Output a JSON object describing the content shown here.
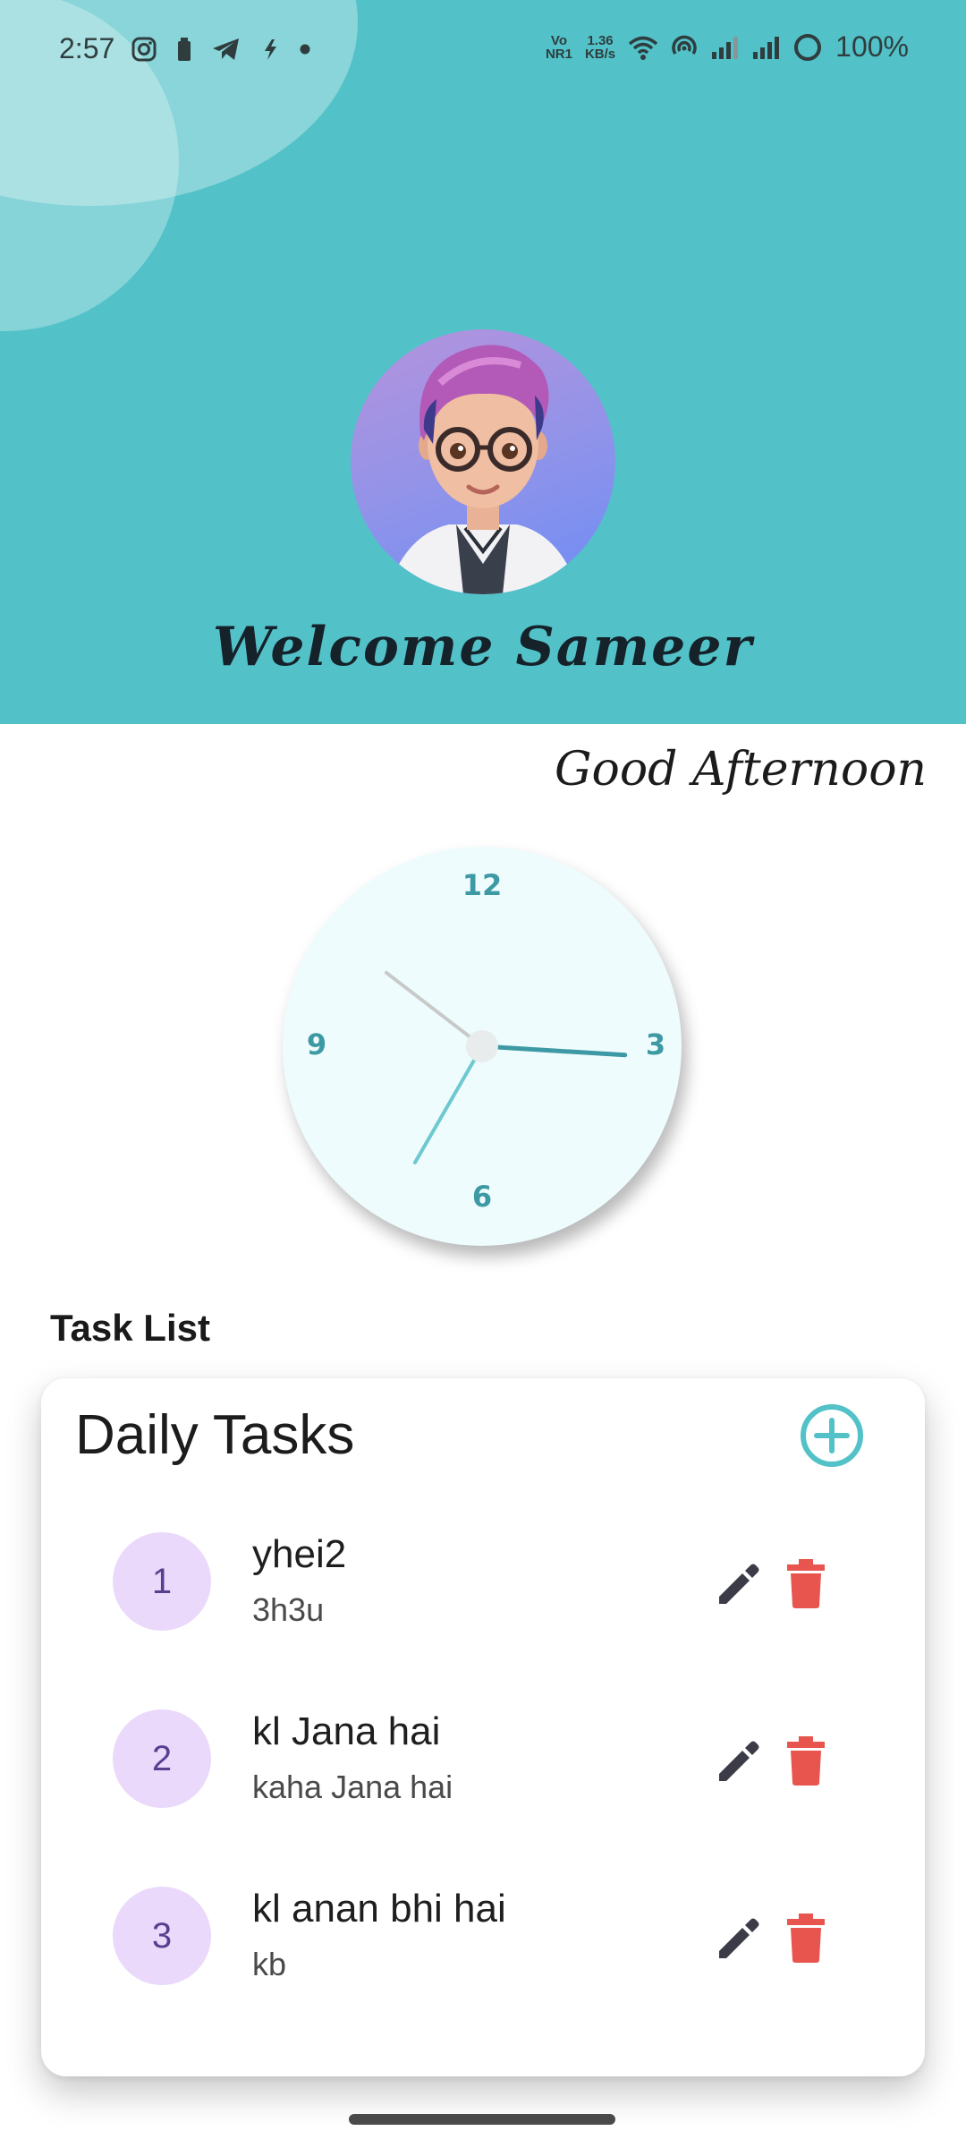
{
  "status_bar": {
    "time": "2:57",
    "network_speed_value": "1.36",
    "network_speed_unit": "KB/s",
    "volte_top": "Vo",
    "volte_bottom": "NR1",
    "battery": "100%"
  },
  "header": {
    "welcome": "Welcome Sameer",
    "background_color": "#52c2c8"
  },
  "greeting": "Good Afternoon",
  "clock": {
    "numbers": {
      "twelve": "12",
      "three": "3",
      "six": "6",
      "nine": "9"
    },
    "time_shown": {
      "hour": 10,
      "minute": 15,
      "second": 35
    }
  },
  "task_list": {
    "label": "Task List",
    "card_title": "Daily Tasks",
    "tasks": [
      {
        "number": "1",
        "title": "yhei2",
        "subtitle": "3h3u"
      },
      {
        "number": "2",
        "title": "kl Jana hai",
        "subtitle": "kaha Jana hai"
      },
      {
        "number": "3",
        "title": "kl anan bhi hai",
        "subtitle": "kb"
      }
    ]
  },
  "colors": {
    "accent": "#52c2c8",
    "delete": "#e8554e",
    "edit": "#3c3c48",
    "number_badge": "#ead9fb"
  },
  "icons": {
    "add": "add-circle-icon",
    "edit": "pencil-icon",
    "delete": "trash-icon"
  }
}
